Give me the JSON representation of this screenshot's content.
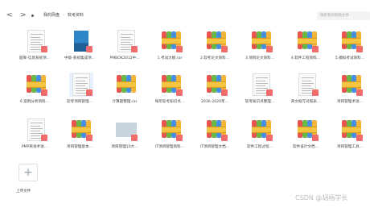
{
  "toolbar": {
    "back_glyph": "<",
    "forward_glyph": ">",
    "search_placeholder": "搜索我的网盘文件"
  },
  "breadcrumbs": [
    "我的网盘",
    "软考资料"
  ],
  "files": [
    {
      "name": "题库-信息系统项...",
      "icon": "document-thumbnail",
      "badge": true
    },
    {
      "name": "中级-系统集成项...",
      "icon": "book-cover-thumbnail",
      "badge": true
    },
    {
      "name": "PMBOK2012中...",
      "icon": "document-thumbnail",
      "badge": true
    },
    {
      "name": "1.考试大纲.rar",
      "icon": "rar-archive-icon",
      "badge": true
    },
    {
      "name": "2.软考论文资料...",
      "icon": "rar-archive-icon",
      "badge": true
    },
    {
      "name": "3.项目论文资料...",
      "icon": "rar-archive-icon",
      "badge": true
    },
    {
      "name": "4.软件工程资料...",
      "icon": "rar-archive-icon",
      "badge": true
    },
    {
      "name": "5.模拟考试资料...",
      "icon": "rar-archive-icon",
      "badge": true
    },
    {
      "name": "6.案例分析资料...",
      "icon": "rar-archive-icon",
      "badge": true
    },
    {
      "name": "软考项目管理...",
      "icon": "document-thumbnail",
      "badge": true,
      "selected": true
    },
    {
      "name": "计算题整理.rar",
      "icon": "rar-archive-icon",
      "badge": false
    },
    {
      "name": "每年软考知识点...",
      "icon": "rar-archive-icon",
      "badge": true
    },
    {
      "name": "2016-2020年...",
      "icon": "rar-archive-icon",
      "badge": true
    },
    {
      "name": "软考知识点整理...",
      "icon": "document-thumbnail",
      "badge": true
    },
    {
      "name": "英文缩写对照表...",
      "icon": "document-thumbnail",
      "badge": true
    },
    {
      "name": "项目管理术语...",
      "icon": "rar-archive-icon",
      "badge": true
    },
    {
      "name": "PMP英语术语...",
      "icon": "document-thumbnail",
      "badge": true
    },
    {
      "name": "项目管理基本...",
      "icon": "rar-archive-icon",
      "badge": true
    },
    {
      "name": "项目管理10大...",
      "icon": "image-thumbnail",
      "badge": true
    },
    {
      "name": "IT项目管理资料...",
      "icon": "rar-archive-icon",
      "badge": true
    },
    {
      "name": "IT项目管理文档...",
      "icon": "rar-archive-icon",
      "badge": true
    },
    {
      "name": "软件工程过程...",
      "icon": "rar-archive-icon",
      "badge": true
    },
    {
      "name": "软件设计文档...",
      "icon": "rar-archive-icon",
      "badge": true
    },
    {
      "name": "项目管理工具...",
      "icon": "rar-archive-icon",
      "badge": true
    }
  ],
  "upload": {
    "label": "上传文件",
    "glyph": "+"
  },
  "watermark": "CSDN @胡杨学长",
  "colors": {
    "badge": "#f16b6b",
    "selected": "#e8f1ff"
  }
}
